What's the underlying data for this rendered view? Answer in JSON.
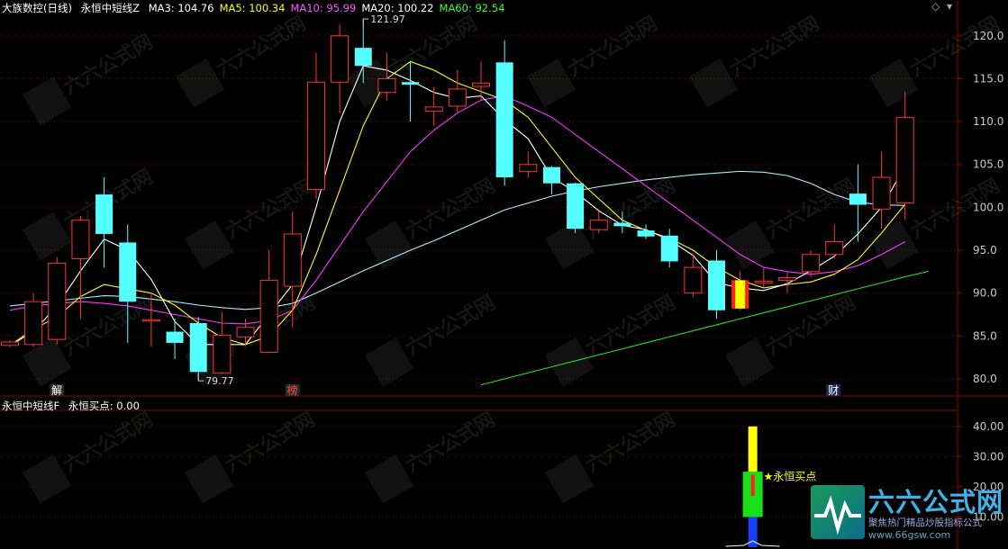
{
  "main_panel": {
    "stock_title": "大族数控(日线)",
    "indicator_name": "永恒中短线Z",
    "ma": [
      {
        "label": "MA3: 104.76",
        "color": "#ffffff"
      },
      {
        "label": "MA5: 100.34",
        "color": "#ffff00"
      },
      {
        "label": "MA10: 95.99",
        "color": "#ff55ff"
      },
      {
        "label": "MA20: 100.22",
        "color": "#ffffff"
      },
      {
        "label": "MA60: 92.54",
        "color": "#33ff33"
      }
    ],
    "annotations": {
      "high": "121.97",
      "low": "79.77"
    },
    "event_markers": [
      "解",
      "榜",
      "财"
    ]
  },
  "sub_panel": {
    "indicator_name": "永恒中短线F",
    "signal_label": "永恒买点: 0.00",
    "buy_marker": "★永恒买点"
  },
  "watermark": {
    "brand": "六六公式网",
    "slogan": "聚焦热门精品炒股指标公式",
    "url": "www.66gsw.com"
  },
  "colors": {
    "up": "#ff3333",
    "down": "#54ffff",
    "ma3": "#ffffff",
    "ma5": "#ffff00",
    "ma10": "#ff33ff",
    "ma20": "#aaf0ff",
    "ma60": "#22dd22",
    "grid": "#7a0000"
  },
  "chart_data": [
    {
      "type": "candlestick",
      "title": "",
      "y_ticks": [
        "120.0",
        "115.0",
        "110.0",
        "105.0",
        "100.0",
        "95.0",
        "90.0",
        "85.0",
        "80.0"
      ],
      "ylim": [
        78,
        122.5
      ],
      "candles": [
        [
          83.9,
          84.3,
          83.7,
          84.5
        ],
        [
          84.0,
          89.0,
          83.7,
          90.0
        ],
        [
          84.6,
          93.5,
          84.0,
          94.2
        ],
        [
          94.0,
          98.5,
          87.0,
          99.0
        ],
        [
          101.5,
          96.9,
          93.0,
          103.5
        ],
        [
          95.9,
          89.0,
          84.2,
          98.0
        ],
        [
          86.8,
          86.9,
          83.8,
          90.0
        ],
        [
          85.5,
          84.2,
          82.3,
          87.0
        ],
        [
          86.5,
          80.8,
          79.8,
          87.2
        ],
        [
          80.7,
          85.1,
          80.6,
          87.8
        ],
        [
          84.9,
          86.0,
          84.0,
          87.0
        ],
        [
          83.1,
          91.5,
          83.0,
          95.0
        ],
        [
          90.8,
          96.9,
          86.0,
          99.5
        ],
        [
          102.1,
          114.6,
          101.0,
          118.0
        ],
        [
          114.6,
          120.0,
          111.0,
          121.3
        ],
        [
          118.6,
          116.5,
          114.5,
          121.97
        ],
        [
          113.4,
          115.0,
          112.5,
          118.0
        ],
        [
          114.6,
          114.3,
          110.0,
          117.0
        ],
        [
          111.2,
          111.7,
          109.5,
          114.0
        ],
        [
          111.8,
          113.8,
          111.0,
          116.0
        ],
        [
          114.1,
          114.5,
          112.5,
          117.0
        ],
        [
          116.9,
          103.5,
          102.5,
          119.5
        ],
        [
          104.2,
          105.0,
          103.5,
          106.5
        ],
        [
          104.7,
          102.8,
          101.5,
          104.8
        ],
        [
          102.8,
          97.5,
          97.0,
          102.9
        ],
        [
          97.4,
          98.5,
          97.0,
          99.5
        ],
        [
          98.2,
          97.8,
          97.0,
          99.5
        ],
        [
          97.3,
          96.6,
          96.3,
          98.0
        ],
        [
          96.7,
          93.7,
          93.0,
          97.5
        ],
        [
          90.0,
          93.0,
          89.5,
          94.5
        ],
        [
          93.8,
          88.0,
          87.0,
          95.0
        ],
        [
          88.2,
          91.5,
          88.0,
          92.5
        ],
        [
          91.2,
          91.4,
          90.7,
          93.0
        ],
        [
          91.5,
          91.8,
          90.0,
          92.5
        ],
        [
          92.5,
          94.5,
          91.8,
          95.0
        ],
        [
          94.5,
          96.0,
          94.0,
          98.0
        ],
        [
          101.6,
          100.3,
          96.0,
          105.0
        ],
        [
          99.8,
          103.5,
          97.5,
          106.5
        ],
        [
          100.5,
          110.5,
          98.5,
          113.5
        ]
      ],
      "ma3": [
        83.9,
        85.5,
        88.5,
        92.6,
        96.3,
        95.0,
        91.6,
        86.7,
        84.0,
        84.0,
        84.0,
        87.5,
        91.0,
        100.0,
        110.0,
        116.5,
        116.0,
        114.8,
        113.4,
        112.7,
        113.0,
        110.2,
        108.0,
        103.5,
        101.8,
        99.6,
        97.9,
        97.4,
        96.2,
        94.4,
        91.2,
        90.6,
        90.3,
        91.1,
        92.6,
        94.3,
        96.9,
        100.0,
        104.76
      ],
      "ma5": [
        83.9,
        85.8,
        87.2,
        89.6,
        91.0,
        90.5,
        90.0,
        88.6,
        86.5,
        84.8,
        84.0,
        85.0,
        88.0,
        94.5,
        102.0,
        109.5,
        115.0,
        117.0,
        116.0,
        114.5,
        113.5,
        112.5,
        110.5,
        107.0,
        103.5,
        101.0,
        98.5,
        97.3,
        96.4,
        95.0,
        93.0,
        91.5,
        90.6,
        91.0,
        91.3,
        92.2,
        93.9,
        97.0,
        100.34
      ],
      "ma10": [
        88.0,
        88.5,
        88.8,
        89.0,
        88.8,
        88.5,
        88.0,
        87.5,
        87.0,
        86.5,
        86.4,
        86.8,
        88.0,
        91.5,
        95.5,
        99.5,
        103.0,
        106.5,
        109.0,
        111.0,
        112.5,
        113.0,
        111.8,
        110.5,
        108.5,
        106.5,
        104.5,
        102.5,
        100.5,
        98.5,
        96.5,
        94.5,
        93.0,
        92.5,
        92.2,
        92.5,
        93.2,
        94.5,
        95.99
      ],
      "ma20": [
        88.5,
        88.8,
        89.1,
        89.4,
        89.7,
        89.6,
        89.3,
        89.0,
        88.6,
        88.3,
        88.1,
        88.3,
        88.8,
        90.0,
        91.3,
        92.6,
        93.8,
        95.0,
        96.1,
        97.3,
        98.5,
        99.7,
        100.5,
        101.3,
        101.9,
        102.4,
        102.8,
        103.2,
        103.5,
        103.8,
        104.0,
        104.2,
        104.1,
        103.7,
        102.8,
        101.5,
        100.6,
        100.3,
        100.22
      ],
      "ma60_start_index": 20,
      "ma60": [
        79.3,
        80.0,
        80.7,
        81.4,
        82.1,
        82.8,
        83.5,
        84.2,
        84.9,
        85.6,
        86.3,
        87.0,
        87.7,
        88.4,
        89.1,
        89.8,
        90.5,
        91.2,
        91.9,
        92.54
      ]
    },
    {
      "type": "bar",
      "title": "",
      "y_ticks": [
        "40.00",
        "30.00",
        "20.00",
        "10.00"
      ],
      "ylim": [
        0,
        45
      ],
      "signal_index": 31,
      "segments": [
        {
          "name": "blue",
          "from": 0,
          "to": 10
        },
        {
          "name": "green",
          "from": 10,
          "to": 25
        },
        {
          "name": "yellow",
          "from": 25,
          "to": 40
        },
        {
          "name": "red",
          "from": 17,
          "to": 24
        }
      ]
    }
  ]
}
